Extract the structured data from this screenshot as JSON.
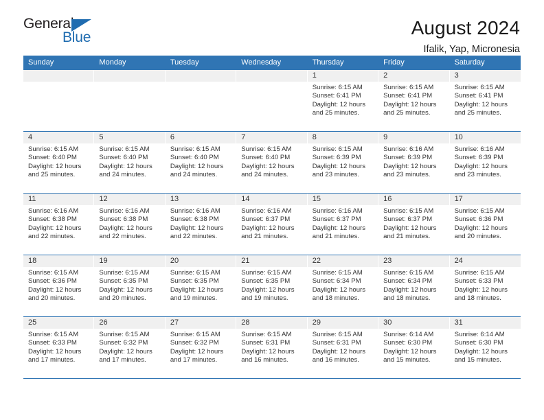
{
  "brand": {
    "name_top": "General",
    "name_bottom": "Blue",
    "triangle_color": "#1f6cb0"
  },
  "header": {
    "title": "August 2024",
    "subtitle": "Ifalik, Yap, Micronesia"
  },
  "theme": {
    "header_blue": "#3075b4",
    "daynum_bg": "#f0f0f0",
    "text": "#333333"
  },
  "weekdays": [
    "Sunday",
    "Monday",
    "Tuesday",
    "Wednesday",
    "Thursday",
    "Friday",
    "Saturday"
  ],
  "weeks": [
    [
      {
        "day": "",
        "lines": []
      },
      {
        "day": "",
        "lines": []
      },
      {
        "day": "",
        "lines": []
      },
      {
        "day": "",
        "lines": []
      },
      {
        "day": "1",
        "lines": [
          "Sunrise: 6:15 AM",
          "Sunset: 6:41 PM",
          "Daylight: 12 hours",
          "and 25 minutes."
        ]
      },
      {
        "day": "2",
        "lines": [
          "Sunrise: 6:15 AM",
          "Sunset: 6:41 PM",
          "Daylight: 12 hours",
          "and 25 minutes."
        ]
      },
      {
        "day": "3",
        "lines": [
          "Sunrise: 6:15 AM",
          "Sunset: 6:41 PM",
          "Daylight: 12 hours",
          "and 25 minutes."
        ]
      }
    ],
    [
      {
        "day": "4",
        "lines": [
          "Sunrise: 6:15 AM",
          "Sunset: 6:40 PM",
          "Daylight: 12 hours",
          "and 25 minutes."
        ]
      },
      {
        "day": "5",
        "lines": [
          "Sunrise: 6:15 AM",
          "Sunset: 6:40 PM",
          "Daylight: 12 hours",
          "and 24 minutes."
        ]
      },
      {
        "day": "6",
        "lines": [
          "Sunrise: 6:15 AM",
          "Sunset: 6:40 PM",
          "Daylight: 12 hours",
          "and 24 minutes."
        ]
      },
      {
        "day": "7",
        "lines": [
          "Sunrise: 6:15 AM",
          "Sunset: 6:40 PM",
          "Daylight: 12 hours",
          "and 24 minutes."
        ]
      },
      {
        "day": "8",
        "lines": [
          "Sunrise: 6:15 AM",
          "Sunset: 6:39 PM",
          "Daylight: 12 hours",
          "and 23 minutes."
        ]
      },
      {
        "day": "9",
        "lines": [
          "Sunrise: 6:16 AM",
          "Sunset: 6:39 PM",
          "Daylight: 12 hours",
          "and 23 minutes."
        ]
      },
      {
        "day": "10",
        "lines": [
          "Sunrise: 6:16 AM",
          "Sunset: 6:39 PM",
          "Daylight: 12 hours",
          "and 23 minutes."
        ]
      }
    ],
    [
      {
        "day": "11",
        "lines": [
          "Sunrise: 6:16 AM",
          "Sunset: 6:38 PM",
          "Daylight: 12 hours",
          "and 22 minutes."
        ]
      },
      {
        "day": "12",
        "lines": [
          "Sunrise: 6:16 AM",
          "Sunset: 6:38 PM",
          "Daylight: 12 hours",
          "and 22 minutes."
        ]
      },
      {
        "day": "13",
        "lines": [
          "Sunrise: 6:16 AM",
          "Sunset: 6:38 PM",
          "Daylight: 12 hours",
          "and 22 minutes."
        ]
      },
      {
        "day": "14",
        "lines": [
          "Sunrise: 6:16 AM",
          "Sunset: 6:37 PM",
          "Daylight: 12 hours",
          "and 21 minutes."
        ]
      },
      {
        "day": "15",
        "lines": [
          "Sunrise: 6:16 AM",
          "Sunset: 6:37 PM",
          "Daylight: 12 hours",
          "and 21 minutes."
        ]
      },
      {
        "day": "16",
        "lines": [
          "Sunrise: 6:15 AM",
          "Sunset: 6:37 PM",
          "Daylight: 12 hours",
          "and 21 minutes."
        ]
      },
      {
        "day": "17",
        "lines": [
          "Sunrise: 6:15 AM",
          "Sunset: 6:36 PM",
          "Daylight: 12 hours",
          "and 20 minutes."
        ]
      }
    ],
    [
      {
        "day": "18",
        "lines": [
          "Sunrise: 6:15 AM",
          "Sunset: 6:36 PM",
          "Daylight: 12 hours",
          "and 20 minutes."
        ]
      },
      {
        "day": "19",
        "lines": [
          "Sunrise: 6:15 AM",
          "Sunset: 6:35 PM",
          "Daylight: 12 hours",
          "and 20 minutes."
        ]
      },
      {
        "day": "20",
        "lines": [
          "Sunrise: 6:15 AM",
          "Sunset: 6:35 PM",
          "Daylight: 12 hours",
          "and 19 minutes."
        ]
      },
      {
        "day": "21",
        "lines": [
          "Sunrise: 6:15 AM",
          "Sunset: 6:35 PM",
          "Daylight: 12 hours",
          "and 19 minutes."
        ]
      },
      {
        "day": "22",
        "lines": [
          "Sunrise: 6:15 AM",
          "Sunset: 6:34 PM",
          "Daylight: 12 hours",
          "and 18 minutes."
        ]
      },
      {
        "day": "23",
        "lines": [
          "Sunrise: 6:15 AM",
          "Sunset: 6:34 PM",
          "Daylight: 12 hours",
          "and 18 minutes."
        ]
      },
      {
        "day": "24",
        "lines": [
          "Sunrise: 6:15 AM",
          "Sunset: 6:33 PM",
          "Daylight: 12 hours",
          "and 18 minutes."
        ]
      }
    ],
    [
      {
        "day": "25",
        "lines": [
          "Sunrise: 6:15 AM",
          "Sunset: 6:33 PM",
          "Daylight: 12 hours",
          "and 17 minutes."
        ]
      },
      {
        "day": "26",
        "lines": [
          "Sunrise: 6:15 AM",
          "Sunset: 6:32 PM",
          "Daylight: 12 hours",
          "and 17 minutes."
        ]
      },
      {
        "day": "27",
        "lines": [
          "Sunrise: 6:15 AM",
          "Sunset: 6:32 PM",
          "Daylight: 12 hours",
          "and 17 minutes."
        ]
      },
      {
        "day": "28",
        "lines": [
          "Sunrise: 6:15 AM",
          "Sunset: 6:31 PM",
          "Daylight: 12 hours",
          "and 16 minutes."
        ]
      },
      {
        "day": "29",
        "lines": [
          "Sunrise: 6:15 AM",
          "Sunset: 6:31 PM",
          "Daylight: 12 hours",
          "and 16 minutes."
        ]
      },
      {
        "day": "30",
        "lines": [
          "Sunrise: 6:14 AM",
          "Sunset: 6:30 PM",
          "Daylight: 12 hours",
          "and 15 minutes."
        ]
      },
      {
        "day": "31",
        "lines": [
          "Sunrise: 6:14 AM",
          "Sunset: 6:30 PM",
          "Daylight: 12 hours",
          "and 15 minutes."
        ]
      }
    ]
  ]
}
